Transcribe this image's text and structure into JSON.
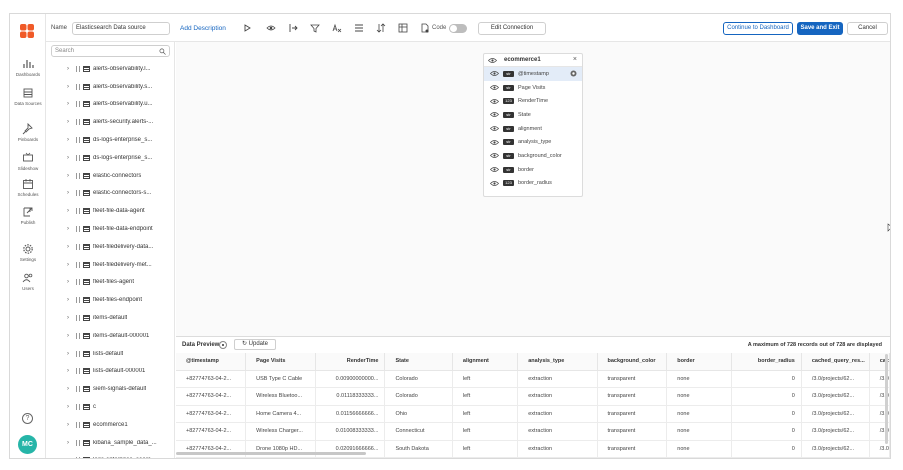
{
  "rail": {
    "items": [
      {
        "label": "Dashboards",
        "icon": "bar-chart-icon"
      },
      {
        "label": "Data Sources",
        "icon": "database-icon"
      },
      {
        "label": "Pinboards",
        "icon": "pin-icon"
      },
      {
        "label": "Slideshow",
        "icon": "slideshow-icon"
      },
      {
        "label": "Schedules",
        "icon": "calendar-icon"
      },
      {
        "label": "Publish",
        "icon": "publish-icon"
      },
      {
        "label": "Settings",
        "icon": "gear-icon"
      },
      {
        "label": "Users",
        "icon": "users-icon"
      }
    ],
    "help": "?",
    "avatar": "MC"
  },
  "toolbar": {
    "name_label": "Name",
    "name_value": "Elasticsearch Data source",
    "add_description": "Add Description",
    "code_label": "Code",
    "edit_connection": "Edit Connection",
    "continue_dashboard": "Continue to Dashboard",
    "save_exit": "Save and Exit",
    "cancel": "Cancel"
  },
  "sidebar": {
    "search_placeholder": "Search",
    "items": [
      "alerts-observability.l...",
      "alerts-observability.s...",
      "alerts-observability.u...",
      "alerts-security.alerts-...",
      "ds-logs-enterprise_s...",
      "ds-logs-enterprise_s...",
      "elastic-connectors",
      "elastic-connectors-s...",
      "fleet-file-data-agent",
      "fleet-file-data-endpoint",
      "fleet-filedelivery-data...",
      "fleet-filedelivery-met...",
      "fleet-files-agent",
      "fleet-files-endpoint",
      "items-default",
      "items-default-000001",
      "lists-default",
      "lists-default-000001",
      "siem-signals-default",
      "c",
      "ecommerce1",
      "kibana_sample_data_...",
      "logs-enterprise_searc..."
    ]
  },
  "card": {
    "title": "ecommerce1",
    "close": "×",
    "fields": [
      {
        "type": "str",
        "name": "@timestamp"
      },
      {
        "type": "str",
        "name": "Page Visits"
      },
      {
        "type": "123",
        "name": "RenderTime"
      },
      {
        "type": "str",
        "name": "State"
      },
      {
        "type": "str",
        "name": "alignment"
      },
      {
        "type": "str",
        "name": "analysis_type"
      },
      {
        "type": "str",
        "name": "background_color"
      },
      {
        "type": "str",
        "name": "border"
      },
      {
        "type": "123",
        "name": "border_radius"
      }
    ]
  },
  "preview": {
    "title": "Data Preview",
    "update": "Update",
    "max_records": "A maximum of 728 records out of 728 are displayed",
    "columns": [
      "@timestamp",
      "Page Visits",
      "RenderTime",
      "State",
      "alignment",
      "analysis_type",
      "background_color",
      "border",
      "border_radius",
      "cached_query_res...",
      "cac"
    ],
    "rows": [
      [
        "+82774763-04-2...",
        "USB Type C Cable",
        "0.00900000000...",
        "Colorado",
        "left",
        "extraction",
        "transparent",
        "none",
        "0",
        "/3.0/projects/62...",
        "/3.0"
      ],
      [
        "+82774763-04-2...",
        "Wireless Bluetoo...",
        "0.01118333333...",
        "Colorado",
        "left",
        "extraction",
        "transparent",
        "none",
        "0",
        "/3.0/projects/62...",
        "/3.0"
      ],
      [
        "+82774763-04-2...",
        "Home Camera 4...",
        "0.01156666666...",
        "Ohio",
        "left",
        "extraction",
        "transparent",
        "none",
        "0",
        "/3.0/projects/62...",
        "/3.0"
      ],
      [
        "+82774763-04-2...",
        "Wireless Charger...",
        "0.01008333333...",
        "Connecticut",
        "left",
        "extraction",
        "transparent",
        "none",
        "0",
        "/3.0/projects/62...",
        "/3.0"
      ],
      [
        "+82774763-04-2...",
        "Drone 1080p HD...",
        "0.02091666666...",
        "South Dakota",
        "left",
        "extraction",
        "transparent",
        "none",
        "0",
        "/3.0/projects/62...",
        "/3.0"
      ]
    ]
  },
  "colors": {
    "accent": "#1565c0",
    "logo": "#f05a28",
    "avatar": "#26b5a8"
  }
}
